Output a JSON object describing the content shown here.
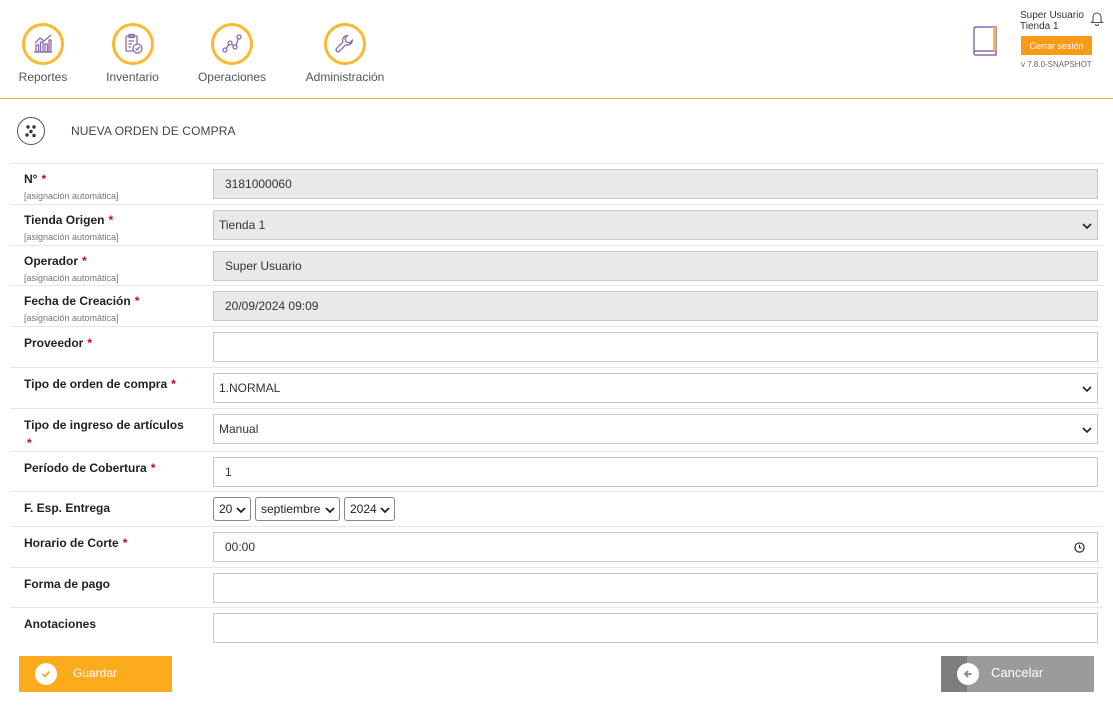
{
  "nav": {
    "items": [
      {
        "label": "Reportes",
        "icon": "chart-icon"
      },
      {
        "label": "Inventario",
        "icon": "clipboard-check-icon"
      },
      {
        "label": "Operaciones",
        "icon": "network-icon"
      },
      {
        "label": "Administración",
        "icon": "wrench-icon"
      }
    ]
  },
  "user": {
    "name": "Super Usuario",
    "store": "Tienda 1",
    "logout_label": "Cerrar sesión",
    "version": "v 7.8.0-SNAPSHOT"
  },
  "page": {
    "title": "NUEVA ORDEN DE COMPRA"
  },
  "form": {
    "auto_hint": "[asignación automática]",
    "required_mark": "*",
    "numero": {
      "label": "N°",
      "value": "3181000060"
    },
    "tienda_origen": {
      "label": "Tienda Origen",
      "value": "Tienda 1"
    },
    "operador": {
      "label": "Operador",
      "value": "Super Usuario"
    },
    "fecha_creacion": {
      "label": "Fecha de Creación",
      "value": "20/09/2024 09:09"
    },
    "proveedor": {
      "label": "Proveedor",
      "value": ""
    },
    "tipo_orden": {
      "label": "Tipo de orden de compra",
      "value": "1.NORMAL"
    },
    "tipo_ingreso": {
      "label": "Tipo de ingreso de artículos",
      "value": "Manual"
    },
    "periodo_cobertura": {
      "label": "Período de Cobertura",
      "value": "1"
    },
    "fecha_entrega": {
      "label": "F. Esp. Entrega",
      "day": "20",
      "month": "septiembre",
      "year": "2024"
    },
    "horario_corte": {
      "label": "Horario de Corte",
      "value": "00:00"
    },
    "forma_pago": {
      "label": "Forma de pago",
      "value": ""
    },
    "anotaciones": {
      "label": "Anotaciones",
      "value": ""
    }
  },
  "actions": {
    "save_label": "Guardar",
    "cancel_label": "Cancelar"
  },
  "colors": {
    "accent": "#fbb932",
    "save": "#fcab1c",
    "logout": "#fb9a16",
    "cancel": "#9b9b9b",
    "required": "#d0021b"
  }
}
